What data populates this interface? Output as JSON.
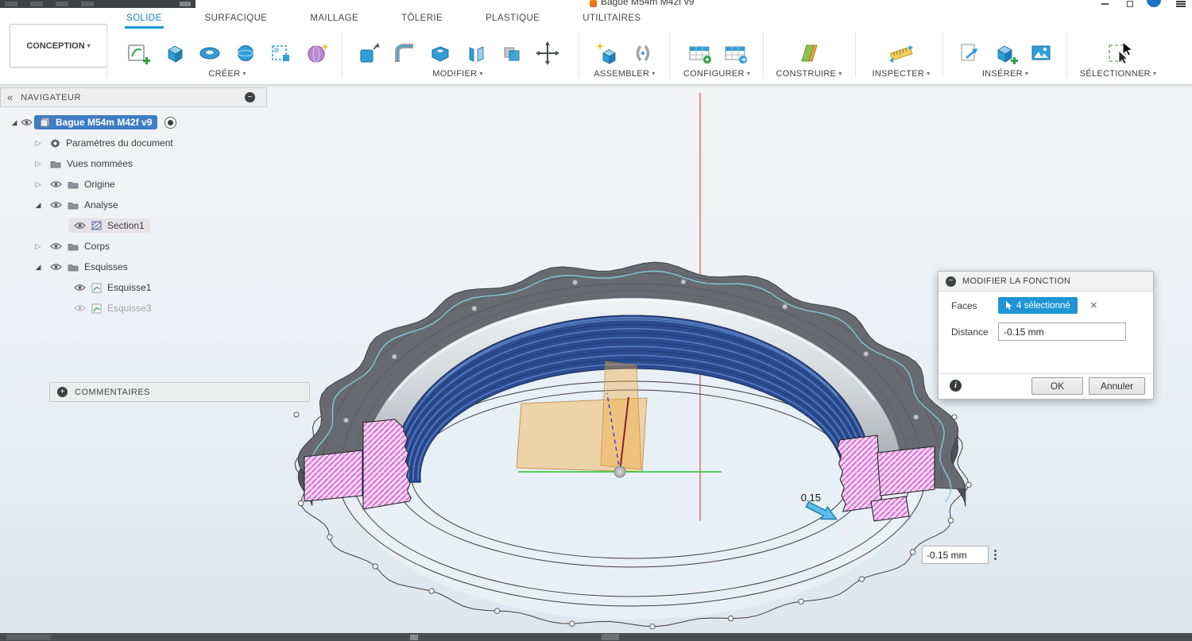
{
  "titlebar": {
    "document_title": "Bague M54m M42f v9"
  },
  "ribbon": {
    "conception_label": "CONCEPTION",
    "tabs": [
      {
        "key": "solide",
        "label": "SOLIDE",
        "active": true
      },
      {
        "key": "surfacique",
        "label": "SURFACIQUE",
        "active": false
      },
      {
        "key": "maillage",
        "label": "MAILLAGE",
        "active": false
      },
      {
        "key": "tolerie",
        "label": "TÔLERIE",
        "active": false
      },
      {
        "key": "plastique",
        "label": "PLASTIQUE",
        "active": false
      },
      {
        "key": "utilitaires",
        "label": "UTILITAIRES",
        "active": false
      }
    ],
    "group_labels": [
      "CRÉER",
      "MODIFIER",
      "ASSEMBLER",
      "CONFIGURER",
      "CONSTRUIRE",
      "INSPECTER",
      "INSÉRER",
      "SÉLECTIONNER"
    ]
  },
  "navigator": {
    "title": "NAVIGATEUR",
    "tree": [
      {
        "key": "root",
        "label": "Bague M54m M42f v9",
        "level": 0,
        "arrow": "expanded",
        "icons": [
          "eye",
          "document"
        ],
        "selected": true,
        "radio": true
      },
      {
        "key": "parametres-document",
        "label": "Paramètres du document",
        "level": 1,
        "arrow": "collapsed",
        "icons": [
          "gear"
        ]
      },
      {
        "key": "vues-nommees",
        "label": "Vues nommées",
        "level": 1,
        "arrow": "collapsed",
        "icons": [
          "folder"
        ]
      },
      {
        "key": "origine",
        "label": "Origine",
        "level": 1,
        "arrow": "collapsed",
        "icons": [
          "eye",
          "folder"
        ]
      },
      {
        "key": "analyse",
        "label": "Analyse",
        "level": 1,
        "arrow": "expanded",
        "icons": [
          "eye",
          "folder"
        ]
      },
      {
        "key": "section1",
        "label": "Section1",
        "level": 2,
        "arrow": null,
        "icons": [
          "eye",
          "section"
        ],
        "highlight": true
      },
      {
        "key": "corps",
        "label": "Corps",
        "level": 1,
        "arrow": "collapsed",
        "icons": [
          "eye",
          "folder"
        ]
      },
      {
        "key": "esquisses",
        "label": "Esquisses",
        "level": 1,
        "arrow": "expanded",
        "icons": [
          "eye",
          "folder"
        ]
      },
      {
        "key": "esquisse1",
        "label": "Esquisse1",
        "level": 2,
        "arrow": null,
        "icons": [
          "eye",
          "sketch"
        ]
      },
      {
        "key": "esquisse3",
        "label": "Esquisse3",
        "level": 2,
        "arrow": null,
        "icons": [
          "eye-off",
          "sketch"
        ],
        "muted": true
      }
    ]
  },
  "comments": {
    "label": "COMMENTAIRES"
  },
  "edit_dialog": {
    "title": "MODIFIER LA FONCTION",
    "faces_label": "Faces",
    "faces_chip": "4 sélectionné",
    "distance_label": "Distance",
    "distance_value": "-0.15 mm",
    "ok_label": "OK",
    "cancel_label": "Annuler"
  },
  "viewport": {
    "dim_label": "0.15",
    "distance_input_value": "-0.15 mm",
    "colors": {
      "accent_blue": "#1e95d4",
      "selection_blue": "#3f7dc4",
      "thread_blue": "#2b4c92",
      "section_pink": "#f6d4f4",
      "section_hatch": "#cb4fcd",
      "plane_orange": "#f0b25a",
      "axis_red": "#dc4f4f",
      "axis_green": "#23c52b"
    }
  }
}
